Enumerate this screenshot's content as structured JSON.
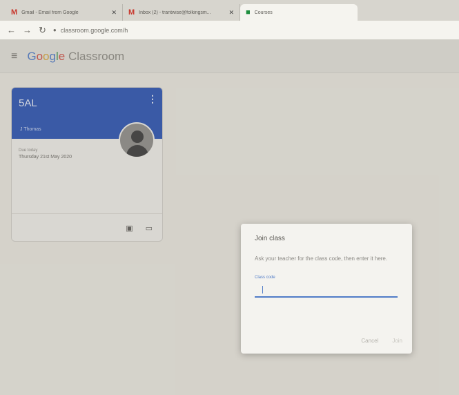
{
  "browser": {
    "tabs": [
      {
        "icon": "M",
        "title": "Gmail - Email from Google",
        "close": "✕"
      },
      {
        "icon": "M",
        "title": "Inbox (2) - trantwise@folkingsm...",
        "close": "✕"
      },
      {
        "icon": "■",
        "title": "Courses",
        "close": ""
      }
    ],
    "back": "←",
    "forward": "→",
    "reload": "↻",
    "url": "classroom.google.com/h"
  },
  "header": {
    "menu_icon": "≡",
    "brand": {
      "g1": "G",
      "g2": "o",
      "g3": "o",
      "g4": "g",
      "g5": "l",
      "g6": "e",
      "product": " Classroom"
    }
  },
  "card": {
    "title": "5AL",
    "teacher": "J Thomas",
    "due_label": "Due today",
    "due_date": "Thursday 21st May 2020",
    "more_icon": "⋮",
    "footer_icons": [
      "▣",
      "▭"
    ]
  },
  "dialog": {
    "title": "Join class",
    "description": "Ask your teacher for the class code, then enter it here.",
    "field_label": "Class code",
    "field_value": "",
    "cancel_label": "Cancel",
    "join_label": "Join"
  },
  "colors": {
    "banner": "#2c55b2",
    "accent": "#4f7bc7"
  }
}
